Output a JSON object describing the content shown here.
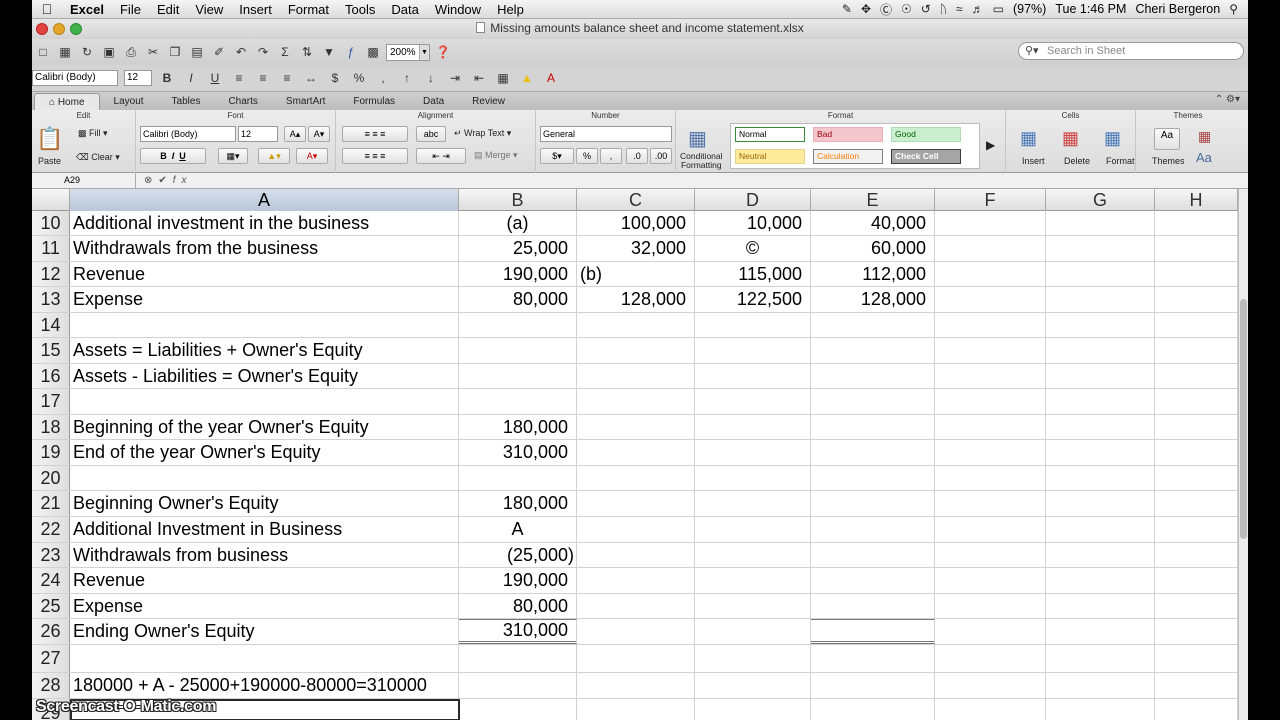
{
  "menubar": {
    "app": "Excel",
    "items": [
      "File",
      "Edit",
      "View",
      "Insert",
      "Format",
      "Tools",
      "Data",
      "Window",
      "Help"
    ],
    "battery": "(97%)",
    "clock": "Tue 1:46 PM",
    "user": "Cheri Bergeron"
  },
  "window": {
    "title": "Missing amounts balance sheet and income statement.xlsx"
  },
  "toolbar": {
    "zoom": "200%",
    "search_placeholder": "Search in Sheet"
  },
  "formatbar": {
    "font": "Calibri (Body)",
    "size": "12"
  },
  "ribbon": {
    "tabs": [
      "Home",
      "Layout",
      "Tables",
      "Charts",
      "SmartArt",
      "Formulas",
      "Data",
      "Review"
    ],
    "active_tab": "Home",
    "groups": {
      "edit": {
        "title": "Edit",
        "paste": "Paste",
        "fill": "Fill",
        "clear": "Clear"
      },
      "font": {
        "title": "Font",
        "font": "Calibri (Body)",
        "size": "12"
      },
      "alignment": {
        "title": "Alignment",
        "wrap": "Wrap Text",
        "abc": "abc",
        "merge": "Merge"
      },
      "number": {
        "title": "Number",
        "format": "General"
      },
      "format": {
        "title": "Format",
        "cond1": "Conditional",
        "cond2": "Formatting",
        "styles": [
          {
            "label": "Normal",
            "bg": "#ffffff",
            "fg": "#000000",
            "border": "#3a8a3a"
          },
          {
            "label": "Bad",
            "bg": "#f4c7ce",
            "fg": "#9c0006",
            "border": "#e6b0b8"
          },
          {
            "label": "Good",
            "bg": "#c9efce",
            "fg": "#006100",
            "border": "#aedcb4"
          },
          {
            "label": "Neutral",
            "bg": "#feeb9c",
            "fg": "#9c6500",
            "border": "#e5d38a"
          },
          {
            "label": "Calculation",
            "bg": "#f2f2f2",
            "fg": "#fa7d00",
            "border": "#7f7f7f"
          },
          {
            "label": "Check Cell",
            "bg": "#a5a5a5",
            "fg": "#ffffff",
            "border": "#3f3f3f"
          }
        ]
      },
      "cells": {
        "title": "Cells",
        "insert": "Insert",
        "delete": "Delete",
        "format": "Format"
      },
      "themes": {
        "title": "Themes",
        "themes": "Themes",
        "aa": "Aa"
      }
    }
  },
  "formula_bar": {
    "name_box": "A29",
    "fx": "fx"
  },
  "columns": [
    "A",
    "B",
    "C",
    "D",
    "E",
    "F",
    "G",
    "H"
  ],
  "selected_column": "A",
  "rows": [
    {
      "n": "10",
      "A": "Additional investment in the business",
      "B": "(a)",
      "C": "100,000",
      "D": "10,000",
      "E": "40,000"
    },
    {
      "n": "11",
      "A": "Withdrawals from the business",
      "B": "25,000",
      "C": "32,000",
      "D": "©",
      "E": "60,000"
    },
    {
      "n": "12",
      "A": "Revenue",
      "B": "190,000",
      "C": "(b)",
      "D": "115,000",
      "E": "112,000"
    },
    {
      "n": "13",
      "A": "Expense",
      "B": "80,000",
      "C": "128,000",
      "D": "122,500",
      "E": "128,000"
    },
    {
      "n": "14"
    },
    {
      "n": "15",
      "A": "Assets = Liabilities + Owner's Equity"
    },
    {
      "n": "16",
      "A": "Assets - Liabilities = Owner's Equity"
    },
    {
      "n": "17"
    },
    {
      "n": "18",
      "A": "Beginning of the year Owner's Equity",
      "B": "180,000"
    },
    {
      "n": "19",
      "A": "End of the year Owner's Equity",
      "B": "310,000"
    },
    {
      "n": "20"
    },
    {
      "n": "21",
      "A": "Beginning Owner's Equity",
      "B": "180,000"
    },
    {
      "n": "22",
      "A": "Additional Investment in Business",
      "B": "A"
    },
    {
      "n": "23",
      "A": "Withdrawals from business",
      "B": "(25,000)"
    },
    {
      "n": "24",
      "A": "Revenue",
      "B": "190,000"
    },
    {
      "n": "25",
      "A": "Expense",
      "B": "80,000"
    },
    {
      "n": "26",
      "A": "Ending Owner's Equity",
      "B": "310,000"
    },
    {
      "n": "27"
    },
    {
      "n": "28",
      "A": "180000 + A - 25000+190000-80000=310000"
    },
    {
      "n": "29"
    }
  ],
  "watermark": "Screencast-O-Matic.com"
}
